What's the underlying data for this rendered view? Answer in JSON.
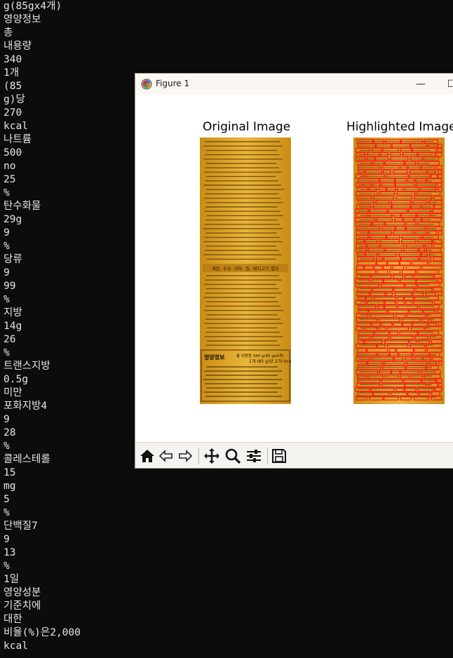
{
  "terminal": {
    "lines": [
      "g(85gx4개)",
      "영양정보",
      "총",
      "내용량",
      "340",
      "1개",
      "(85",
      "g)당",
      "270",
      "kcal",
      "나트륨",
      "500",
      "no",
      "25",
      "%",
      "탄수화물",
      "29g",
      "9",
      "%",
      "당류",
      "9",
      "99",
      "%",
      "지방",
      "14g",
      "26",
      "%",
      "트랜스지방",
      "0.5g",
      "미만",
      "포화지방4",
      "9",
      "28",
      "%",
      "콜레스테롤",
      "15",
      "mg",
      "5",
      "%",
      "단백질7",
      "9",
      "13",
      "%",
      "1일",
      "영양성분",
      "기준치에",
      "대한",
      "비율(%)은2,000",
      "kcal"
    ]
  },
  "window": {
    "title": "Figure 1",
    "minimize_glyph": "—",
    "maximize_glyph": "☐"
  },
  "figure": {
    "left_title": "Original Image",
    "right_title": "Highlighted Image",
    "package_fragments": {
      "allergy_line": "계란, 우유, 대두, 밀, 돼지고기 함유",
      "nutrition_header": "영양정보",
      "total_line": "총 내용량 340 g(85 gx4개)",
      "per_serving": "1개 (85 g)당 270 kcal",
      "row_sodium": "나트륨 500 mg 25%",
      "row_carb": "탄수화물 29 g 9%",
      "row_sugar": "당류 9 g 9%",
      "row_fat": "지방 14 g 26%",
      "row_trans": "트랜스지방 0.5 g 미만",
      "row_sat": "포화지방 4 g 28%",
      "row_chol": "콜레스테롤 15 mg 5%",
      "row_protein": "단백질 7 g 13%",
      "footnote": "1일 영양성분 기준치에 대한 비율(%)은 2,000 kcal"
    },
    "colors": {
      "package_yellow": "#e2ac2a",
      "package_dark": "#b97f12",
      "highlight_red": "#ff1a1a"
    }
  },
  "toolbar": {
    "icons": [
      "home-icon",
      "back-arrow-icon",
      "forward-arrow-icon",
      "pan-icon",
      "zoom-icon",
      "configure-subplots-icon",
      "save-icon"
    ]
  }
}
